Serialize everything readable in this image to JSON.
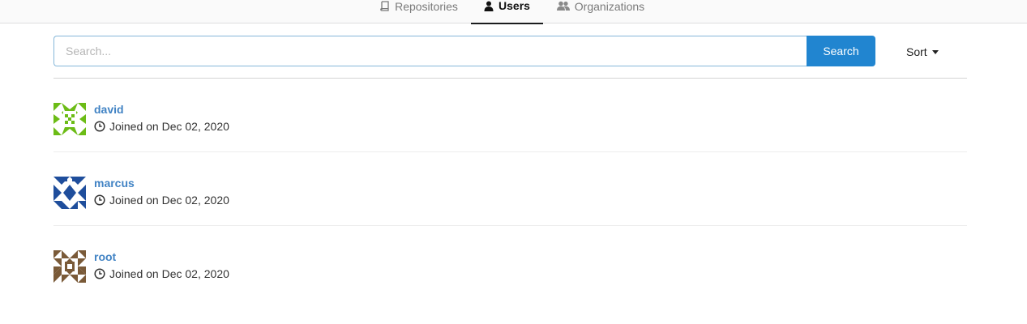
{
  "tabs": [
    {
      "label": "Repositories",
      "icon": "book-icon",
      "active": false
    },
    {
      "label": "Users",
      "icon": "user-icon",
      "active": true
    },
    {
      "label": "Organizations",
      "icon": "users-icon",
      "active": false
    }
  ],
  "search": {
    "placeholder": "Search...",
    "value": "",
    "button_label": "Search"
  },
  "sort": {
    "label": "Sort"
  },
  "users": [
    {
      "name": "david",
      "joined_prefix": "Joined on",
      "joined_date": "Dec 02, 2020",
      "avatar_color": "#6cbc16"
    },
    {
      "name": "marcus",
      "joined_prefix": "Joined on",
      "joined_date": "Dec 02, 2020",
      "avatar_color": "#1f4e9c"
    },
    {
      "name": "root",
      "joined_prefix": "Joined on",
      "joined_date": "Dec 02, 2020",
      "avatar_color": "#7a5a38"
    }
  ],
  "colors": {
    "accent": "#2185d0",
    "link": "#4183c4",
    "input_focus_border": "#85b7d9"
  }
}
